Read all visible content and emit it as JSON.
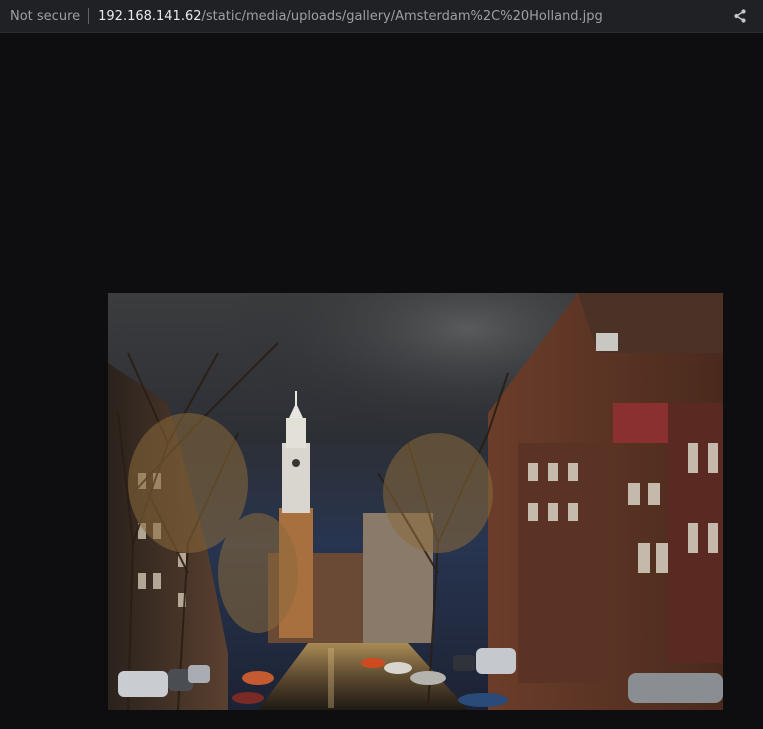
{
  "browser": {
    "security_label": "Not secure",
    "url_host": "192.168.141.62",
    "url_path": "/static/media/uploads/gallery/Amsterdam%2C%20Holland.jpg",
    "share_icon": "share-icon"
  },
  "viewer": {
    "background": "#0e0e10",
    "image_subject": "amsterdam-canal-photo"
  }
}
